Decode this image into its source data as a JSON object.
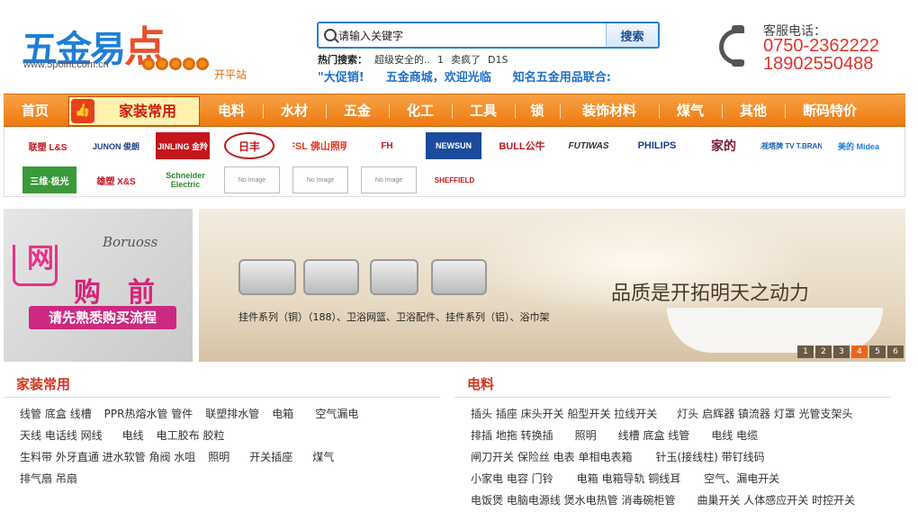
{
  "logo": {
    "brand": "五金易",
    "brand_last": "点",
    "url": "www.5point.com.cn",
    "city": "开平站"
  },
  "search": {
    "value": "请输入关键字",
    "button": "搜索",
    "hot_label": "热门搜索：",
    "hot_terms": [
      "超级安全的..",
      "1",
      "卖疯了",
      "D1S"
    ]
  },
  "promo": [
    "\"大促销!",
    "五金商城，欢迎光临",
    "知名五金用品联合:"
  ],
  "service": {
    "label": "客服电话：",
    "phones": [
      "0750-2362222",
      "18902550488"
    ]
  },
  "nav": {
    "home": "首页",
    "feature": "家装常用",
    "items": [
      "电料",
      "水材",
      "五金",
      "化工",
      "工具",
      "锁",
      "装饰材料",
      "煤气",
      "其他",
      "断码特价"
    ]
  },
  "brands": {
    "row1": [
      "联塑 L&S",
      "JUNON 俊朗",
      "JINLING 金羚",
      "日丰",
      "FSL 佛山照明",
      "FH",
      "NEWSUN",
      "BULL公牛",
      "FUTIWAS",
      "PHILIPS",
      "家的",
      "电视塔牌 TV T.BRAND",
      "美的 Midea"
    ],
    "row2": [
      "三维·极光",
      "雄塑 X&S",
      "Schneider Electric",
      "No Image",
      "No Image",
      "No Image",
      "SHEFFIELD"
    ]
  },
  "left_banner": {
    "script": "Boruoss",
    "line1": "网",
    "line2": "购",
    "line3": "前",
    "cta": "请先熟悉购买流程"
  },
  "main_banner": {
    "slogan": "品质是开拓明天之动力",
    "caption": "挂件系列（铜）（188）、卫浴网篮、卫浴配件、挂件系列（铝）、浴巾架",
    "pages": [
      "1",
      "2",
      "3",
      "4",
      "5",
      "6"
    ],
    "active_page": "4"
  },
  "sections": {
    "left": {
      "title": "家装常用",
      "rows": [
        [
          "线管 底盒 线槽",
          "PPR热熔水管 管件",
          "联塑排水管",
          "电箱",
          "空气漏电"
        ],
        [
          "天线 电话线 网线",
          "电线",
          "电工胶布 胶粒"
        ],
        [
          "生料带 外牙直通 进水软管 角阀 水咀",
          "照明",
          "开关插座",
          "煤气"
        ],
        [
          "排气扇 吊扇"
        ]
      ]
    },
    "right": {
      "title": "电料",
      "rows": [
        [
          "插头 插座 床头开关 船型开关 拉线开关",
          "灯头 启辉器 镇流器 灯罩 光管支架头"
        ],
        [
          "排插 地拖 转换插",
          "照明",
          "线槽 底盒 线管",
          "电线 电缆"
        ],
        [
          "闸刀开关 保险丝 电表 单相电表箱",
          "针玉(接线柱) 带钉线码"
        ],
        [
          "小家电 电容 门铃",
          "电箱 电箱导轨 铜线耳",
          "空气、漏电开关"
        ],
        [
          "电饭煲 电脑电源线 煲水电热管 消毒碗柜管",
          "曲巢开关 人体感应开关 时控开关"
        ]
      ]
    }
  }
}
